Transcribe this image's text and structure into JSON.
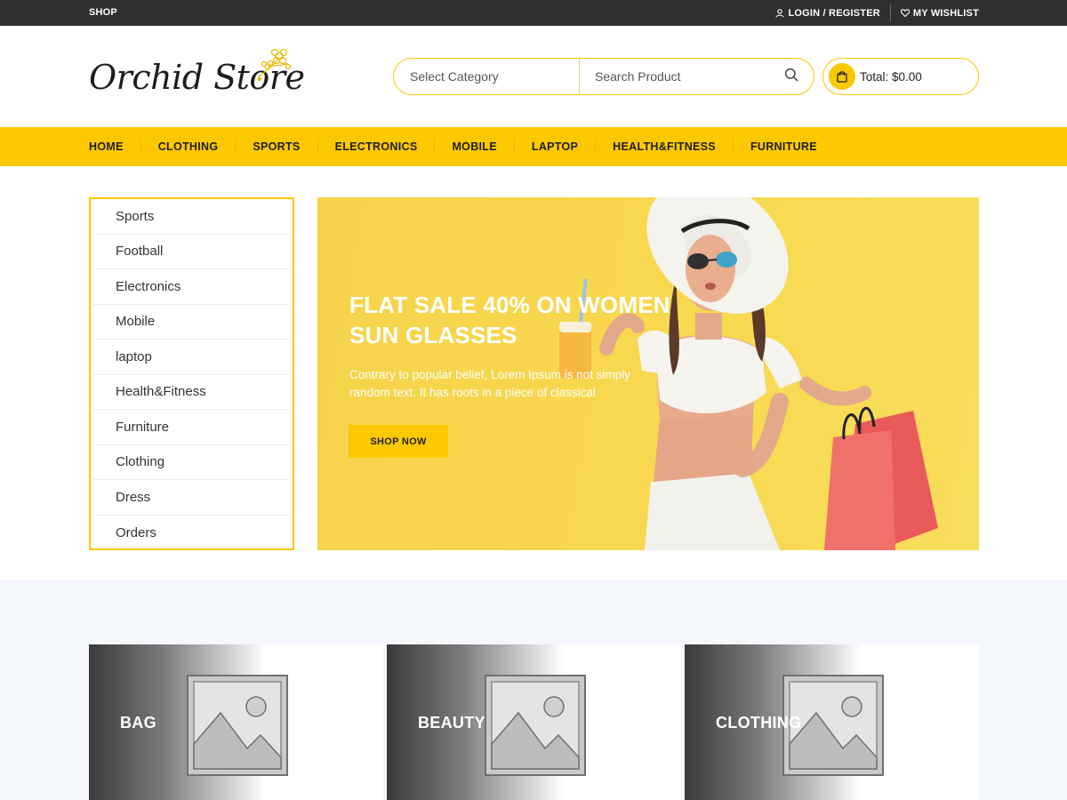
{
  "topbar": {
    "shop_label": "SHOP",
    "login_label": "LOGIN / REGISTER",
    "wishlist_label": "MY WISHLIST",
    "user_icon": "user-icon",
    "heart_icon": "heart-icon"
  },
  "header": {
    "logo_text": "Orchid Store",
    "search": {
      "category_placeholder": "Select Category",
      "product_placeholder": "Search Product",
      "search_icon": "search-icon"
    },
    "cart": {
      "total_label": "Total: $0.00",
      "bag_icon": "shopping-bag-icon"
    }
  },
  "nav": {
    "items": [
      "HOME",
      "CLOTHING",
      "SPORTS",
      "ELECTRONICS",
      "MOBILE",
      "LAPTOP",
      "HEALTH&FITNESS",
      "FURNITURE"
    ]
  },
  "sidebar": {
    "items": [
      "Sports",
      "Football",
      "Electronics",
      "Mobile",
      "laptop",
      "Health&Fitness",
      "Furniture",
      "Clothing",
      "Dress",
      "Orders"
    ]
  },
  "banner": {
    "title_line1": "FLAT SALE 40% ON WOMEN",
    "title_line2": "SUN GLASSES",
    "desc_line1": "Contrary to popular belief, Lorem Ipsum is not simply",
    "desc_line2": "random text. It has roots in a piece of classical",
    "button_label": "SHOP NOW"
  },
  "categories": [
    {
      "label": "BAG",
      "icon": "image-placeholder-icon"
    },
    {
      "label": "BEAUTY",
      "icon": "image-placeholder-icon"
    },
    {
      "label": "CLOTHING",
      "icon": "image-placeholder-icon"
    }
  ],
  "colors": {
    "accent": "#fdc800",
    "topbar": "#2f2f2f",
    "lower_bg": "#f4f7fc"
  }
}
